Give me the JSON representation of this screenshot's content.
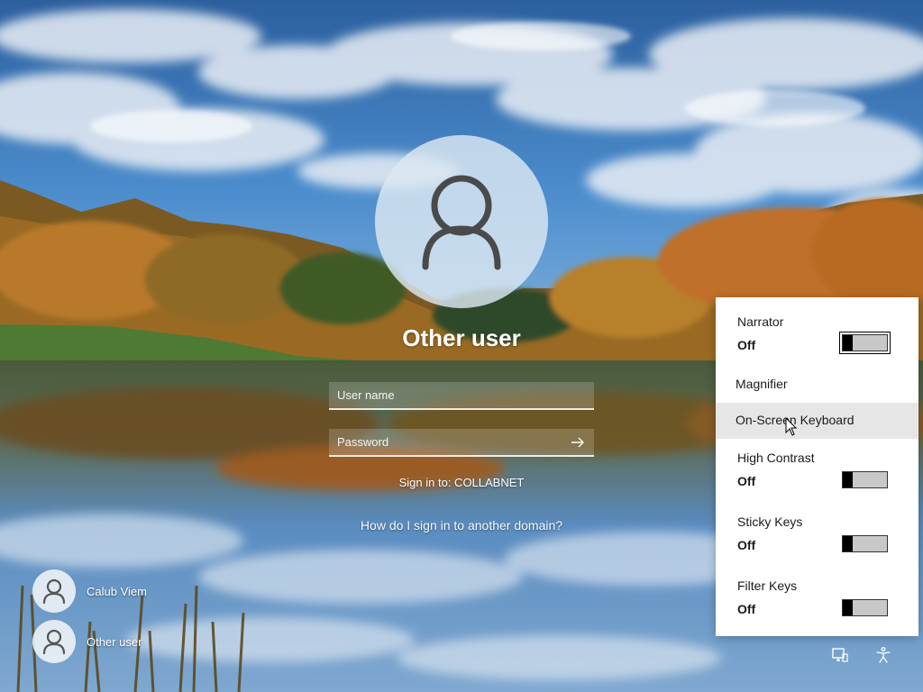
{
  "login": {
    "user_title": "Other user",
    "username_placeholder": "User name",
    "password_placeholder": "Password",
    "sign_in_to": "Sign in to: COLLABNET",
    "other_domain_link": "How do I sign in to another domain?"
  },
  "user_tiles": [
    {
      "name": "Calub Viem"
    },
    {
      "name": "Other user"
    }
  ],
  "accessibility": {
    "narrator": {
      "label": "Narrator",
      "state": "Off"
    },
    "magnifier": {
      "label": "Magnifier"
    },
    "onscreen_keyboard": {
      "label": "On-Screen Keyboard"
    },
    "high_contrast": {
      "label": "High Contrast",
      "state": "Off"
    },
    "sticky_keys": {
      "label": "Sticky Keys",
      "state": "Off"
    },
    "filter_keys": {
      "label": "Filter Keys",
      "state": "Off"
    }
  },
  "icons": {
    "avatar": "person-icon",
    "submit": "arrow-right-icon",
    "network": "network-icon",
    "ease_of_access": "accessibility-icon"
  },
  "colors": {
    "sky": "#3a76b8",
    "flyout_bg": "#ffffff",
    "flyout_hover": "#e6e6e6",
    "toggle_track": "#c8c8c8"
  }
}
